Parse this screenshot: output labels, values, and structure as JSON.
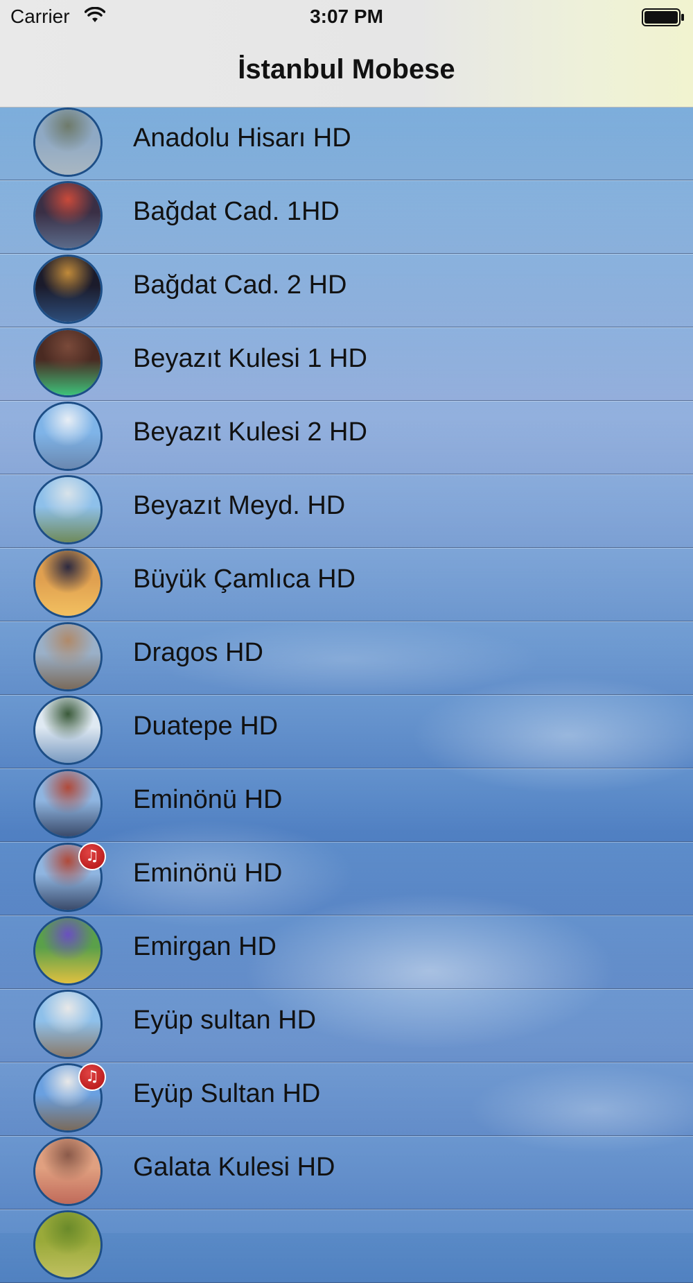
{
  "status_bar": {
    "carrier": "Carrier",
    "time": "3:07 PM",
    "icons": [
      "wifi-icon",
      "battery-icon"
    ]
  },
  "nav": {
    "title": "İstanbul Mobese"
  },
  "list": {
    "items": [
      {
        "label": "Anadolu Hisarı HD",
        "thumb": "anadolu-hisari-thumbnail",
        "badge": false
      },
      {
        "label": "Bağdat Cad. 1HD",
        "thumb": "bagdat-cad-1-thumbnail",
        "badge": false
      },
      {
        "label": "Bağdat Cad. 2 HD",
        "thumb": "bagdat-cad-2-thumbnail",
        "badge": false
      },
      {
        "label": "Beyazıt Kulesi 1 HD",
        "thumb": "beyazit-kulesi-1-thumbnail",
        "badge": false
      },
      {
        "label": "Beyazıt Kulesi 2 HD",
        "thumb": "beyazit-kulesi-2-thumbnail",
        "badge": false
      },
      {
        "label": "Beyazıt Meyd. HD",
        "thumb": "beyazit-meyd-thumbnail",
        "badge": false
      },
      {
        "label": "Büyük Çamlıca HD",
        "thumb": "buyuk-camlica-thumbnail",
        "badge": false
      },
      {
        "label": "Dragos HD",
        "thumb": "dragos-thumbnail",
        "badge": false
      },
      {
        "label": "Duatepe HD",
        "thumb": "duatepe-thumbnail",
        "badge": false
      },
      {
        "label": "Eminönü HD",
        "thumb": "eminonu-thumbnail",
        "badge": false
      },
      {
        "label": "Eminönü HD",
        "thumb": "eminonu-audio-thumbnail",
        "badge": true
      },
      {
        "label": "Emirgan HD",
        "thumb": "emirgan-thumbnail",
        "badge": false
      },
      {
        "label": "Eyüp sultan HD",
        "thumb": "eyup-sultan-thumbnail",
        "badge": false
      },
      {
        "label": "Eyüp Sultan HD",
        "thumb": "eyup-sultan-audio-thumbnail",
        "badge": true
      },
      {
        "label": "Galata Kulesi HD",
        "thumb": "galata-kulesi-thumbnail",
        "badge": false
      },
      {
        "label": "",
        "thumb": "partial-thumbnail",
        "badge": false
      }
    ],
    "badge_icon": "music-note-icon",
    "badge_glyph": "♫"
  }
}
